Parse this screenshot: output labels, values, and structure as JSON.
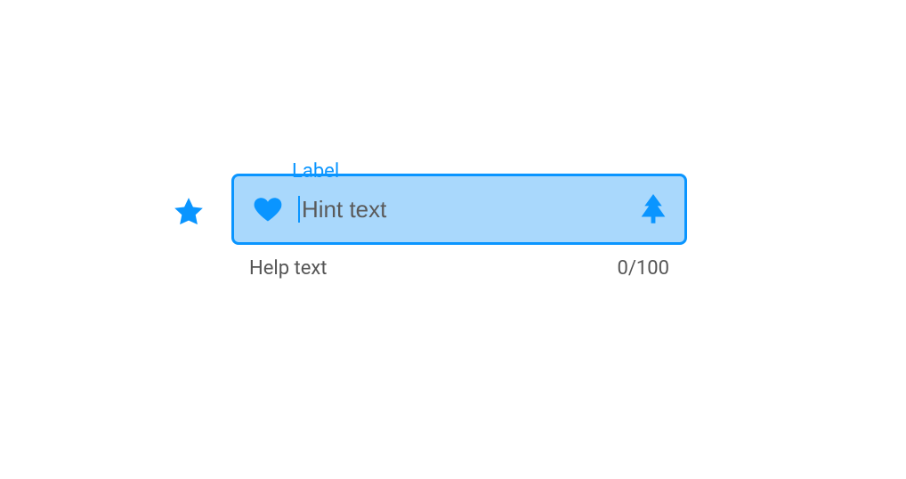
{
  "field": {
    "label": "Label",
    "placeholder": "Hint text",
    "value": "",
    "helper": "Help text",
    "counter": "0/100"
  },
  "icons": {
    "star": "star-icon",
    "heart": "heart-icon",
    "tree": "tree-icon"
  },
  "colors": {
    "primary": "#0a95ff",
    "fill": "#a9d8fc",
    "text_muted": "#555555"
  }
}
